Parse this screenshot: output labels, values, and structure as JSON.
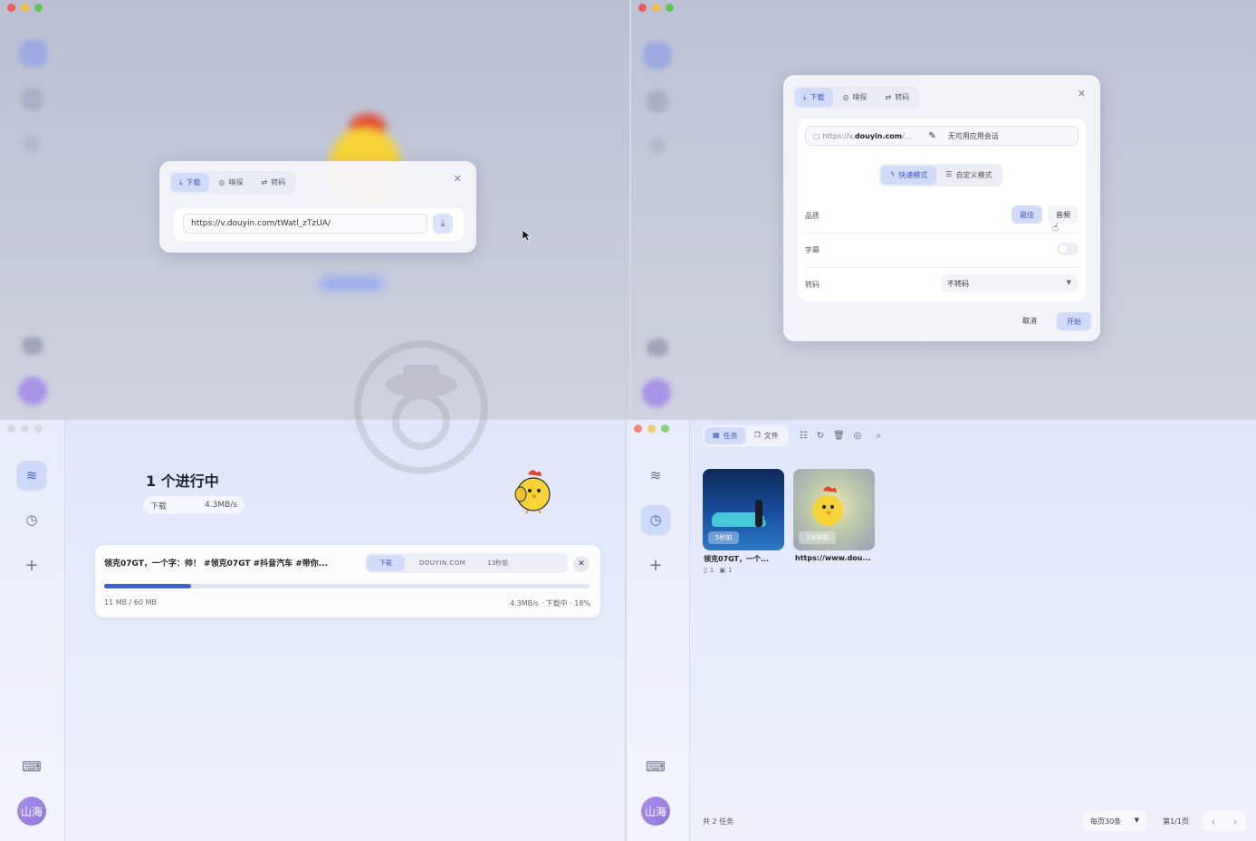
{
  "q1": {
    "modal": {
      "tabs": [
        {
          "label": "下载",
          "icon": "download-icon"
        },
        {
          "label": "嗅探",
          "icon": "radar-icon"
        },
        {
          "label": "转码",
          "icon": "transcode-icon"
        }
      ],
      "url_value": "https://v.douyin.com/tWatl_zTzUA/"
    }
  },
  "q2": {
    "modal": {
      "tabs": [
        {
          "label": "下载",
          "icon": "download-icon"
        },
        {
          "label": "嗅探",
          "icon": "radar-icon"
        },
        {
          "label": "转码",
          "icon": "transcode-icon"
        }
      ],
      "url_prefix": "https://v.",
      "url_domain": "douyin.com",
      "url_suffix": "/...",
      "session_label": "无可用应用会话",
      "modes": [
        {
          "label": "快速模式",
          "icon": "lightning-icon",
          "active": true
        },
        {
          "label": "自定义模式",
          "icon": "sliders-icon",
          "active": false
        }
      ],
      "quality_label": "品质",
      "quality_options": [
        {
          "label": "最佳",
          "active": true
        },
        {
          "label": "音频",
          "active": false
        }
      ],
      "subtitle_label": "字幕",
      "subtitle_on": false,
      "transcode_label": "转码",
      "transcode_value": "不转码",
      "cancel_label": "取消",
      "start_label": "开始"
    }
  },
  "q3": {
    "heading": "1 个进行中",
    "stat_label": "下载",
    "stat_speed": "4.3MB/s",
    "task": {
      "title": "领克07GT，一个字：帅！ #领克07GT #抖音汽车 #带你...",
      "tag_type": "下载",
      "tag_source": "DOUYIN.COM",
      "tag_time": "13秒前",
      "progress": 0.18,
      "size_text": "11 MB / 60 MB",
      "status_text": "4.3MB/s · 下载中 · 18%"
    },
    "avatar_text": "山海"
  },
  "q4": {
    "toolbar": {
      "tab_tasks": "任务",
      "tab_files": "文件"
    },
    "cards": [
      {
        "time": "5秒前",
        "title": "领克07GT，一个...",
        "meta_a": "1",
        "meta_b": "1"
      },
      {
        "time": "1分钟前",
        "title": "https://www.dou..."
      }
    ],
    "footer": {
      "total": "共 2 任务",
      "per_page": "每页30条",
      "page_info": "第1/1页"
    },
    "avatar_text": "山海"
  },
  "colors": {
    "accent": "#4a67d8",
    "progress": "#3f5fd6",
    "traffic_red": "#ee5e57",
    "traffic_yellow": "#f5bd3b",
    "traffic_green": "#5fc84c"
  }
}
